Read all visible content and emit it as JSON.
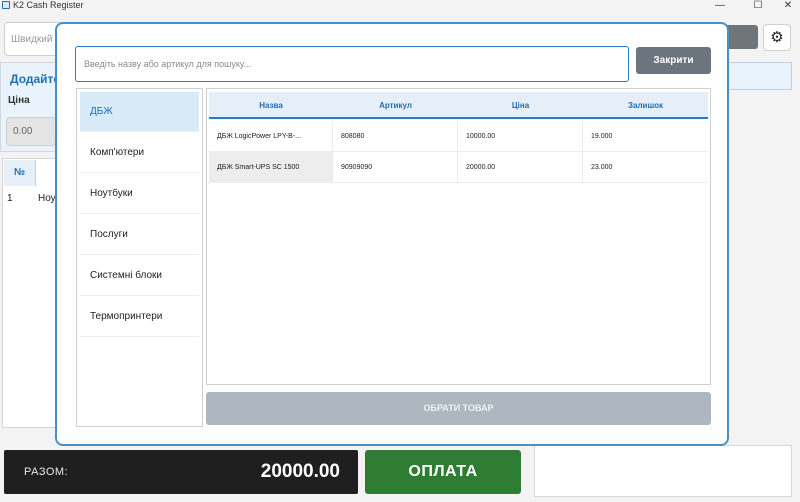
{
  "window": {
    "title": "K2 Cash Register",
    "minimize": "—",
    "maximize": "☐",
    "close": "✕"
  },
  "background": {
    "quick_search_placeholder": "Швидкий",
    "add_panel_title": "Додайте",
    "price_label": "Ціна",
    "price_value": "0.00",
    "table": {
      "col_no": "№",
      "row_no": "1",
      "row_name": "Ноу"
    },
    "settings_icon": "gear-icon"
  },
  "footer": {
    "total_label": "РАЗОМ:",
    "total_value": "20000.00",
    "pay_label": "ОПЛАТА"
  },
  "modal": {
    "search_placeholder": "Введіть назву або артикул для пошуку...",
    "search_value": "",
    "close_label": "Закрити",
    "categories": [
      "ДБЖ",
      "Комп'ютери",
      "Ноутбуки",
      "Послуги",
      "Системні блоки",
      "Термопринтери"
    ],
    "active_category": "ДБЖ",
    "columns": [
      "Назва",
      "Артикул",
      "Ціна",
      "Залишок"
    ],
    "rows": [
      [
        "ДБЖ LogicPower LPY-B-...",
        "808080",
        "10000.00",
        "19.000"
      ],
      [
        "ДБЖ Smart-UPS SC 1500",
        "90909090",
        "20000.00",
        "23.000"
      ]
    ],
    "select_label": "ОБРАТИ ТОВАР"
  },
  "colors": {
    "accent": "#2b7bc1",
    "pay": "#2e7d32",
    "total_bg": "#1f1f1f",
    "disabled_button": "#aeb7bf"
  }
}
